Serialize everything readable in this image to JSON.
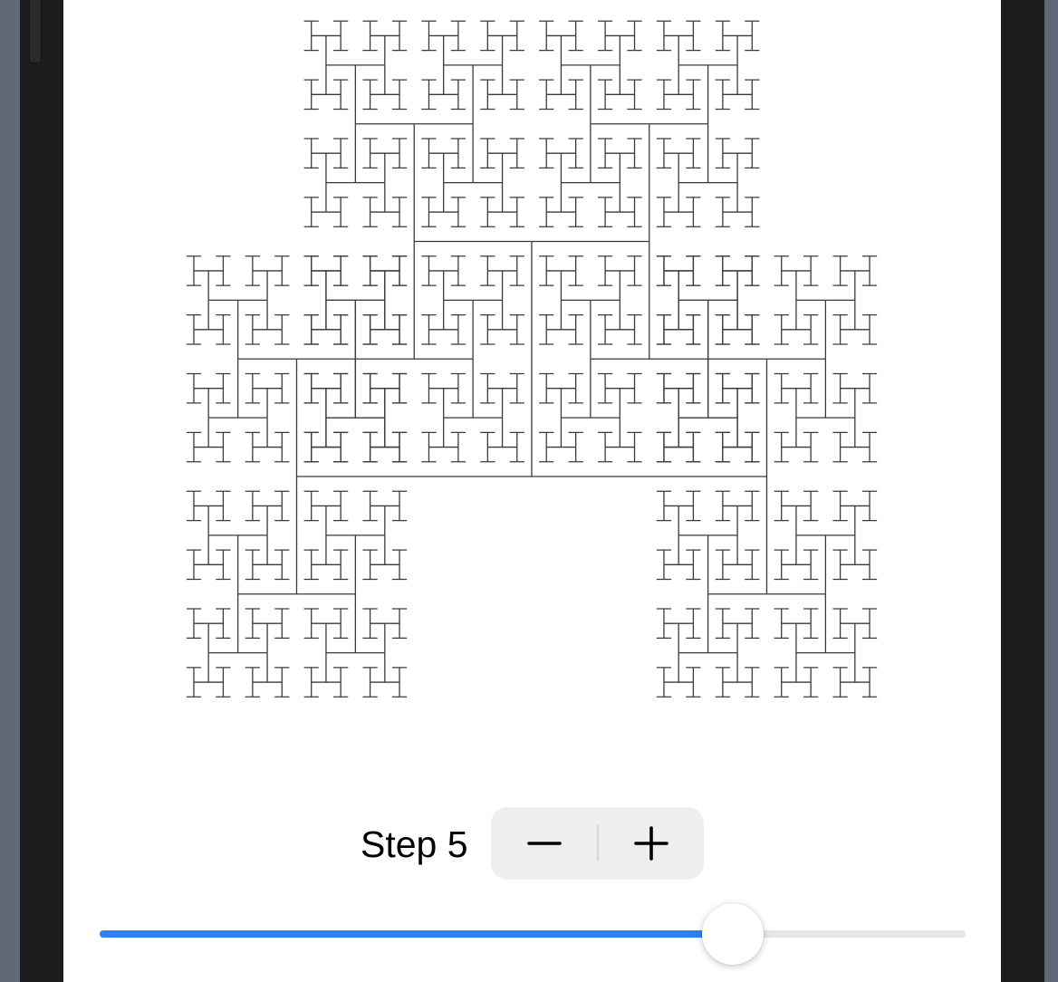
{
  "step": {
    "label": "Step 5",
    "decrement_icon": "minus-icon",
    "increment_icon": "plus-icon"
  },
  "slider": {
    "value_fraction": 0.731,
    "track_color": "#e5e5ea",
    "fill_color": "#2f7ff0"
  },
  "colors": {
    "fractal_stroke": "#3a3a3a",
    "screen_background": "#ffffff",
    "stepper_background": "#eeeeef"
  }
}
